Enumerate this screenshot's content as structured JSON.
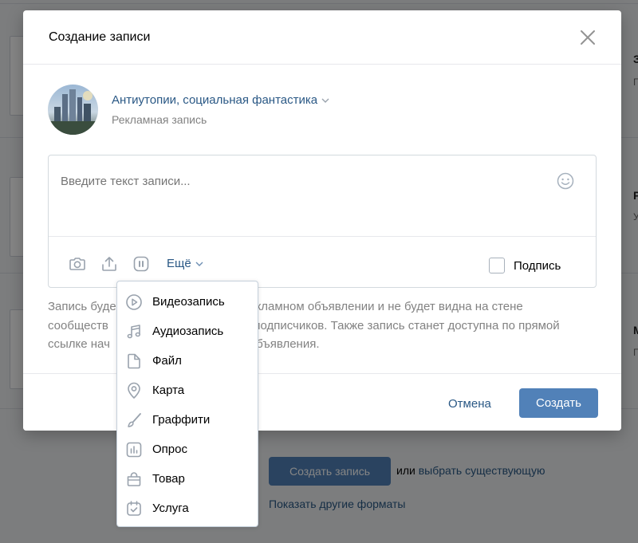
{
  "modal": {
    "title": "Создание записи",
    "author_name": "Антиутопии, социальная фантастика",
    "author_type": "Рекламная запись",
    "editor_placeholder": "Введите текст записи...",
    "more_label": "Ещё",
    "signature_label": "Подпись",
    "info_text": "Запись будет использована в рекламном объявлении и не будет видна на стене сообщества и в новостях у ее подписчиков. Также запись станет доступна по прямой ссылке на странице объявления.",
    "info_visible": {
      "line1_left": "Запись буде",
      "line1_right": "в рекламном объявлении и не будет видна на стене",
      "line2_left": "сообществ",
      "line2_right": "е подписчиков. Также запись станет доступна по прямой",
      "line3_left": "ссылке нач",
      "line3_right": "объявления."
    },
    "cancel_label": "Отмена",
    "create_label": "Создать"
  },
  "dropdown": {
    "items": [
      {
        "label": "Видеозапись",
        "icon": "video-icon"
      },
      {
        "label": "Аудиозапись",
        "icon": "music-icon"
      },
      {
        "label": "Файл",
        "icon": "file-icon"
      },
      {
        "label": "Карта",
        "icon": "map-pin-icon"
      },
      {
        "label": "Граффити",
        "icon": "brush-icon"
      },
      {
        "label": "Опрос",
        "icon": "poll-icon"
      },
      {
        "label": "Товар",
        "icon": "bag-icon"
      },
      {
        "label": "Услуга",
        "icon": "service-icon"
      }
    ]
  },
  "background": {
    "create_post_label": "Создать запись",
    "or_label": "или",
    "choose_existing_label": "выбрать существующую",
    "more_formats_label": "Показать другие форматы",
    "letters": [
      "З",
      "Р",
      "М"
    ]
  },
  "colors": {
    "accent": "#5181b8",
    "link": "#2a5885",
    "muted": "#828282",
    "border": "#d3d9de"
  }
}
